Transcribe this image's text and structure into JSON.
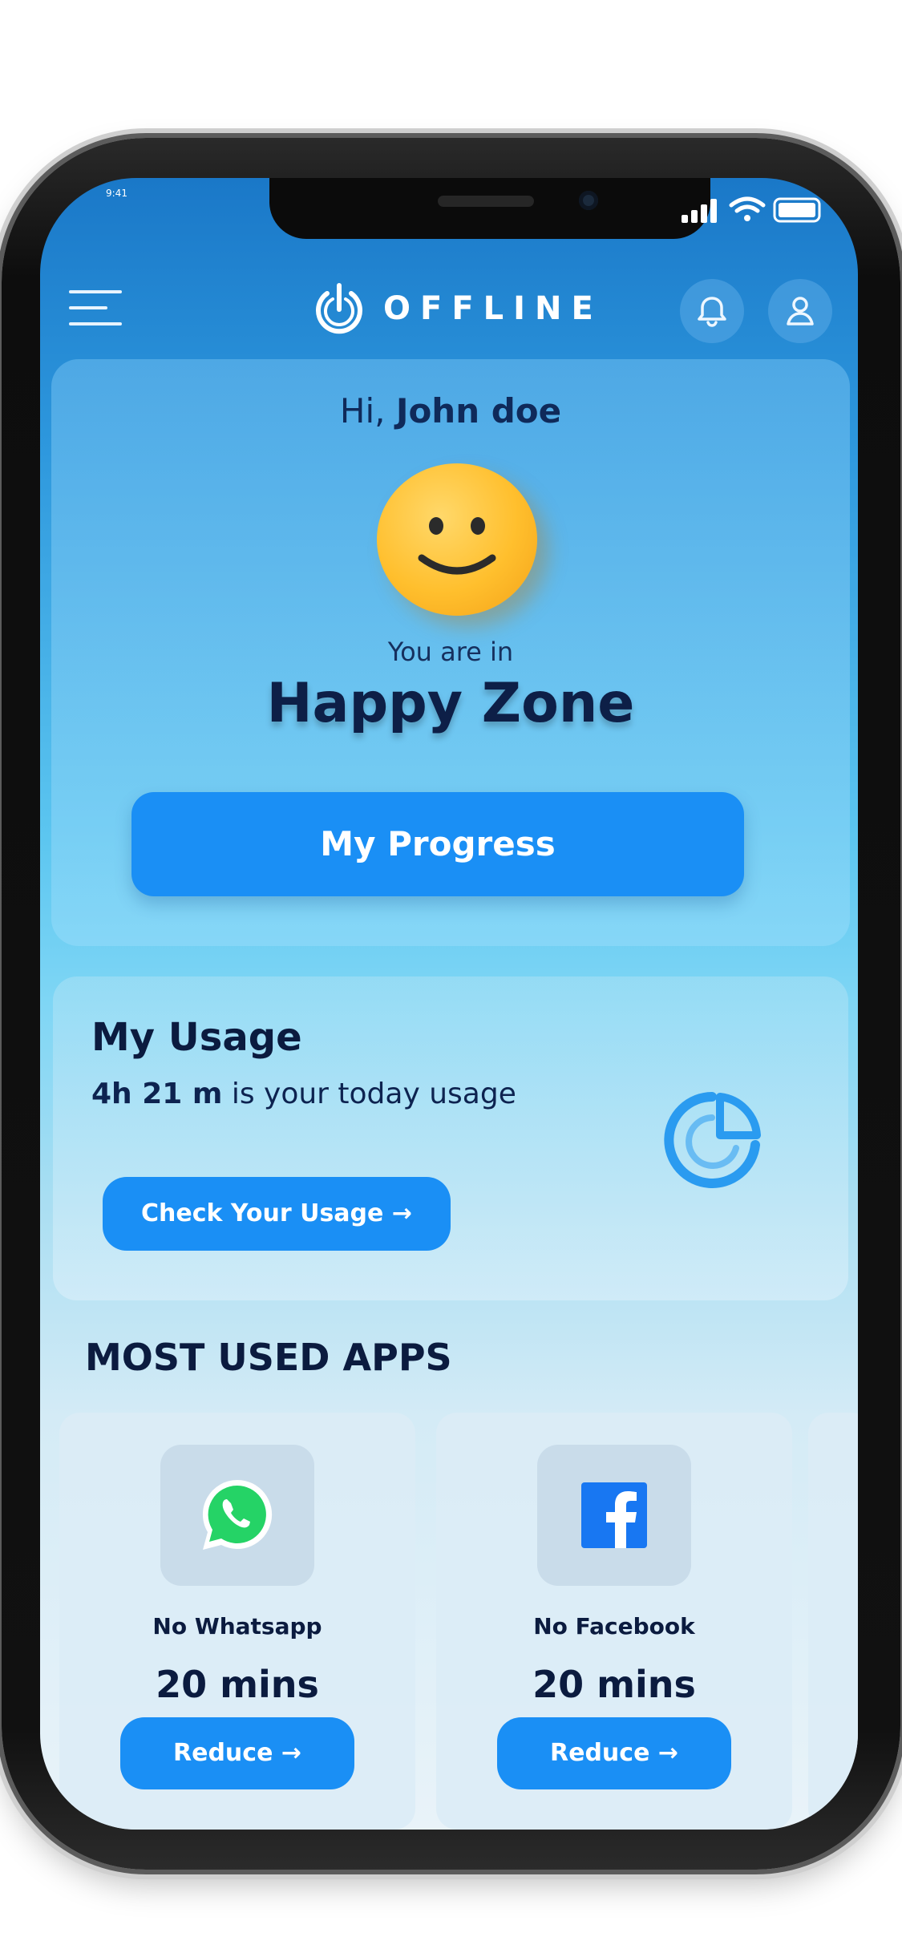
{
  "status": {
    "time": "9:41"
  },
  "header": {
    "brand": "OFFLINE"
  },
  "hero": {
    "greeting_prefix": "Hi,",
    "user_name": "John doe",
    "zone_lead": "You are in",
    "zone": "Happy Zone",
    "progress_button": "My Progress"
  },
  "usage": {
    "title": "My Usage",
    "amount": "4h 21 m",
    "suffix": "is your today usage",
    "button": "Check Your Usage →"
  },
  "apps": {
    "title": "MOST USED APPS",
    "items": [
      {
        "name": "No Whatsapp",
        "time": "20 mins",
        "button": "Reduce →",
        "icon": "whatsapp-icon"
      },
      {
        "name": "No Facebook",
        "time": "20 mins",
        "button": "Reduce →",
        "icon": "facebook-icon"
      }
    ]
  },
  "colors": {
    "accent": "#1a8ff5",
    "text_dark": "#0b1b3f"
  }
}
